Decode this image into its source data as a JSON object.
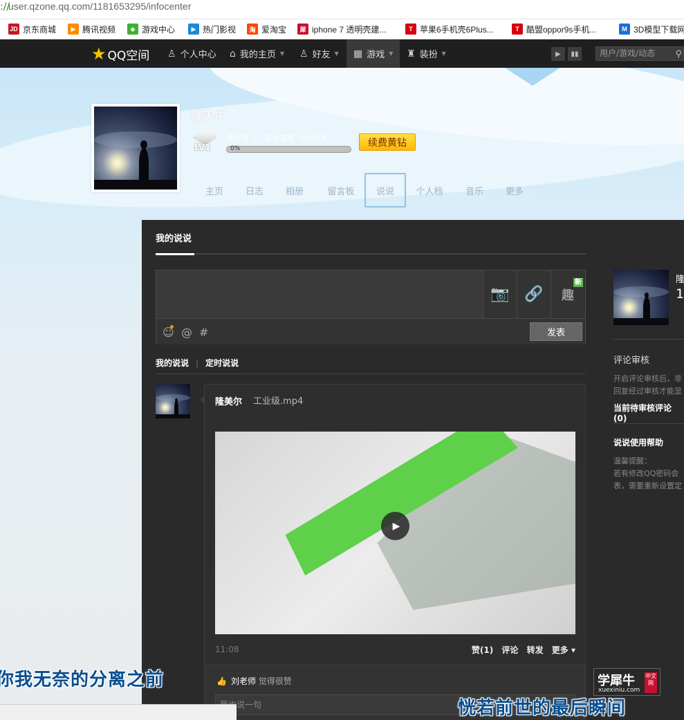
{
  "browser": {
    "scheme": "://",
    "url": "user.qzone.qq.com/1181653295/infocenter",
    "bookmarks": [
      {
        "label": "京东商城",
        "badge": "JD",
        "color": "#c81623"
      },
      {
        "label": "腾讯视频",
        "badge": "▶",
        "color": "#ff8a00"
      },
      {
        "label": "游戏中心",
        "badge": "◆",
        "color": "#3cb034"
      },
      {
        "label": "热门影视",
        "badge": "▶",
        "color": "#1a8ad8"
      },
      {
        "label": "爱淘宝",
        "badge": "淘",
        "color": "#ff4400"
      },
      {
        "label": "iphone 7 透明壳建...",
        "badge": "犀",
        "color": "#c8102e"
      },
      {
        "label": "苹果6手机壳6Plus...",
        "badge": "T",
        "color": "#d7000f"
      },
      {
        "label": "酷盟oppor9s手机...",
        "badge": "T",
        "color": "#d7000f"
      },
      {
        "label": "3D模型下载网",
        "badge": "M",
        "color": "#1a6fd8"
      }
    ]
  },
  "topnav": {
    "logo": "QQ空间",
    "items": [
      {
        "label": "个人中心",
        "icon": "person-icon"
      },
      {
        "label": "我的主页",
        "icon": "home-icon"
      },
      {
        "label": "好友",
        "icon": "friends-icon"
      },
      {
        "label": "游戏",
        "icon": "grid-icon"
      },
      {
        "label": "装扮",
        "icon": "shirt-icon"
      }
    ],
    "search_placeholder": "用户/游戏/动态"
  },
  "profile": {
    "name": "隆美尔",
    "level": "LV1",
    "growth_value": "成长值 1",
    "growth_speed": "成长速度 -10点/天",
    "progress_label": "0%",
    "progress_fraction": 0,
    "renew_label": "续费黄钻",
    "tabs": [
      "主页",
      "日志",
      "相册",
      "留言板",
      "说说",
      "个人档",
      "音乐",
      "更多"
    ],
    "active_tab": "说说"
  },
  "panel": {
    "title": "我的说说",
    "tools": [
      "camera-icon",
      "link-icon",
      "fun-icon"
    ],
    "new_badge": "新",
    "fun_label": "趣",
    "post_label": "发表",
    "subtabs": [
      "我的说说",
      "定时说说"
    ]
  },
  "feed": {
    "author": "隆美尔",
    "attachment": "工业级.mp4",
    "time": "11:08",
    "actions": [
      "赞(1)",
      "评论",
      "转发",
      "更多 ▾"
    ],
    "liker": "刘老师",
    "liker_suffix": "觉得很赞",
    "comment_placeholder": "我也说一句"
  },
  "sidebar": {
    "name_partial": "隆",
    "count_partial": "1",
    "review_title": "评论审核",
    "review_desc_1": "开启评论审核后，非",
    "review_desc_2": "回复经过审核才能显",
    "pending": "当前待审核评论 (0)",
    "help_title": "说说使用帮助",
    "help_hint": "温馨提醒：",
    "help_desc_1": "若有修改QQ密码会",
    "help_desc_2": "表，需要重新设置定"
  },
  "overlay": {
    "subtitle_left": "你我无奈的分离之前",
    "subtitle_right": "恍若前世的最后瞬间",
    "watermark_title": "学犀牛",
    "watermark_url": "xuexiniu.com",
    "watermark_badge": "中文网"
  }
}
